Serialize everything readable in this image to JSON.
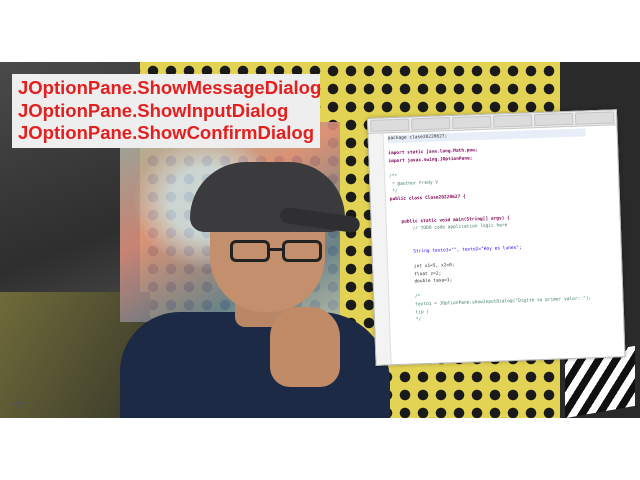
{
  "title_overlay": {
    "lines": [
      "JOptionPane.ShowMessageDialog",
      "JOptionPane.ShowInputDialog",
      "JOptionPane.ShowConfirmDialog"
    ],
    "text_color": "#e41f1f",
    "background_color": "#eeeeee"
  },
  "code_screenshot": {
    "lines": [
      "package clase20220627;",
      "",
      "import static java.lang.Math.pow;",
      "import javax.swing.JOptionPane;",
      "",
      "/**",
      " * @author Fredy V",
      " */",
      "public class Clase20220627 {",
      "",
      "",
      "    public static void main(String[] args) {",
      "        // TODO code application logic here",
      "",
      "",
      "        String texto1=\"\", texto2=\"Hoy es lunes\";",
      "",
      "        int x1=5, x2=0;",
      "        float z=2;",
      "        double tasa=1;",
      "",
      "        /*",
      "        texto1 = JOptionPane.showInputDialog(\"Digite su primer valor: \");",
      "        tip )",
      "        */"
    ]
  },
  "icons": {
    "crosshair": "crosshair-icon"
  }
}
